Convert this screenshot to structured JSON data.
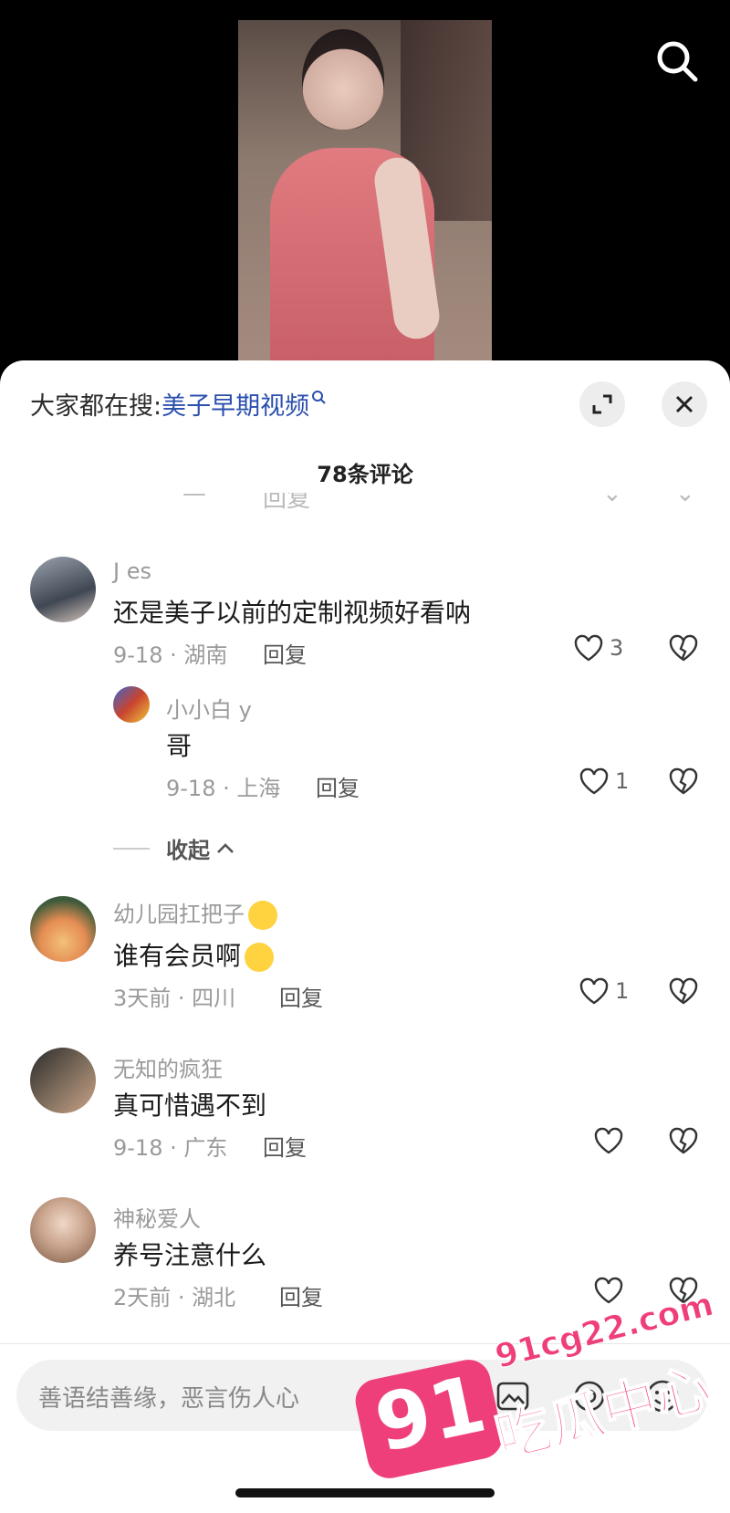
{
  "header": {
    "hot_search_prefix": "大家都在搜:",
    "hot_search_term": "美子早期视频",
    "comment_count": "78条评论"
  },
  "comments": [
    {
      "user": "J es",
      "text": "还是美子以前的定制视频好看呐",
      "date": "9-18 · 湖南",
      "reply": "回复",
      "likes": "3"
    },
    {
      "user": "小小白 y",
      "text": "哥",
      "date": "9-18 · 上海",
      "reply": "回复",
      "likes": "1"
    },
    {
      "user": "幼儿园扛把子",
      "text": "谁有会员啊",
      "date": "3天前 · 四川",
      "reply": "回复",
      "likes": "1"
    },
    {
      "user": "无知的疯狂",
      "text": "真可惜遇不到",
      "date": "9-18 · 广东",
      "reply": "回复",
      "likes": ""
    },
    {
      "user": "神秘爱人",
      "text": "养号注意什么",
      "date": "2天前 · 湖北",
      "reply": "回复",
      "likes": ""
    }
  ],
  "collapse_label": "收起",
  "input": {
    "placeholder": "善语结善缘，恶言伤人心"
  },
  "watermark": {
    "number": "91",
    "domain": "91cg22.com",
    "name": "吃瓜中心"
  },
  "colors": {
    "accent_link": "#2b4fae",
    "watermark": "#ef3f7b"
  }
}
